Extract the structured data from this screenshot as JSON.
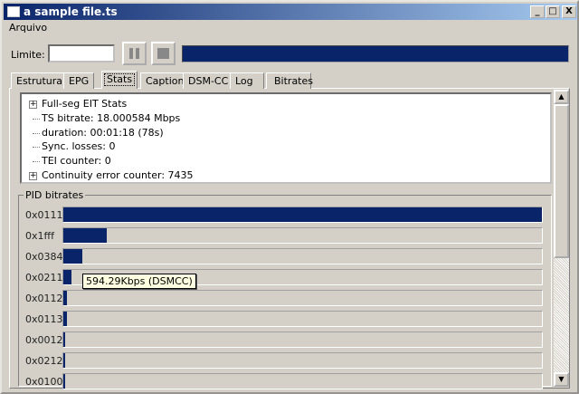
{
  "window": {
    "title": "a sample file.ts",
    "controls": [
      "_",
      "□",
      "X"
    ]
  },
  "menu": [
    "Arquivo"
  ],
  "toolbar": {
    "limit_label": "Limite:",
    "limit_value": "",
    "progress": 1.0
  },
  "tabs": [
    "Estrutura",
    "EPG",
    "Stats",
    "Caption",
    "DSM-CC",
    "Log",
    "Bitrates"
  ],
  "active_tab": "Stats",
  "stats": [
    {
      "text": "Full-seg EIT Stats",
      "expandable": true
    },
    {
      "text": "TS bitrate: 18.000584 Mbps",
      "expandable": false
    },
    {
      "text": "duration: 00:01:18 (78s)",
      "expandable": false
    },
    {
      "text": "Sync. losses: 0",
      "expandable": false
    },
    {
      "text": "TEI counter: 0",
      "expandable": false
    },
    {
      "text": "Continuity error counter: 7435",
      "expandable": true
    }
  ],
  "pid_group_label": "PID bitrates",
  "pids": [
    {
      "pid": "0x0111",
      "fraction": 1.0
    },
    {
      "pid": "0x1fff",
      "fraction": 0.09
    },
    {
      "pid": "0x0384",
      "fraction": 0.04
    },
    {
      "pid": "0x0211",
      "fraction": 0.017
    },
    {
      "pid": "0x0112",
      "fraction": 0.008
    },
    {
      "pid": "0x0113",
      "fraction": 0.008
    },
    {
      "pid": "0x0012",
      "fraction": 0.002
    },
    {
      "pid": "0x0212",
      "fraction": 0.002
    },
    {
      "pid": "0x0100",
      "fraction": 0.002
    }
  ],
  "tooltip": "594.29Kbps (DSMCC)",
  "colors": {
    "accent": "#0a246a"
  }
}
